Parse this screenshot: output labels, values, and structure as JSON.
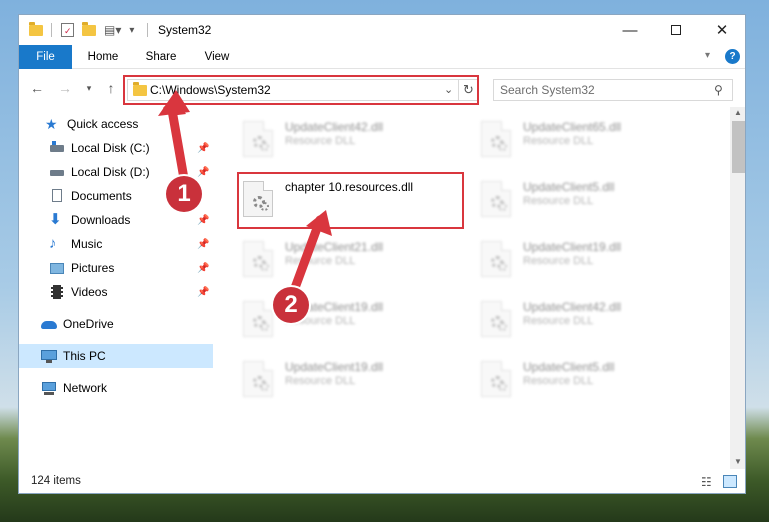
{
  "window": {
    "title": "System32"
  },
  "ribbon": {
    "tabs": [
      "File",
      "Home",
      "Share",
      "View"
    ]
  },
  "address": {
    "path": "C:\\Windows\\System32"
  },
  "search": {
    "placeholder": "Search System32"
  },
  "sidebar": {
    "items": [
      {
        "label": "Quick access",
        "icon": "star-icon"
      },
      {
        "label": "Local Disk (C:)",
        "icon": "drive-icon"
      },
      {
        "label": "Local Disk (D:)",
        "icon": "drive-icon"
      },
      {
        "label": "Documents",
        "icon": "documents-icon"
      },
      {
        "label": "Downloads",
        "icon": "downloads-icon"
      },
      {
        "label": "Music",
        "icon": "music-icon"
      },
      {
        "label": "Pictures",
        "icon": "pictures-icon"
      },
      {
        "label": "Videos",
        "icon": "videos-icon"
      },
      {
        "label": "OneDrive",
        "icon": "cloud-icon"
      },
      {
        "label": "This PC",
        "icon": "computer-icon"
      },
      {
        "label": "Network",
        "icon": "network-icon"
      }
    ]
  },
  "files": [
    {
      "name": "UpdateClient42.dll",
      "type": "Resource DLL"
    },
    {
      "name": "UpdateClient65.dll",
      "type": "Resource DLL"
    },
    {
      "name": "chapter 10.resources.dll",
      "type": ""
    },
    {
      "name": "UpdateClient5.dll",
      "type": "Resource DLL"
    },
    {
      "name": "UpdateClient21.dll",
      "type": "Resource DLL"
    },
    {
      "name": "UpdateClient19.dll",
      "type": "Resource DLL"
    },
    {
      "name": "UpdateClient19.dll",
      "type": "Resource DLL"
    },
    {
      "name": "UpdateClient42.dll",
      "type": "Resource DLL"
    },
    {
      "name": "UpdateClient19.dll",
      "type": "Resource DLL"
    },
    {
      "name": "UpdateClient5.dll",
      "type": "Resource DLL"
    }
  ],
  "status": {
    "count": "124 items"
  },
  "annotations": {
    "step1": "1",
    "step2": "2"
  },
  "colors": {
    "accent": "#1979ca",
    "highlight": "#d9363e",
    "selection": "#cce8ff"
  }
}
